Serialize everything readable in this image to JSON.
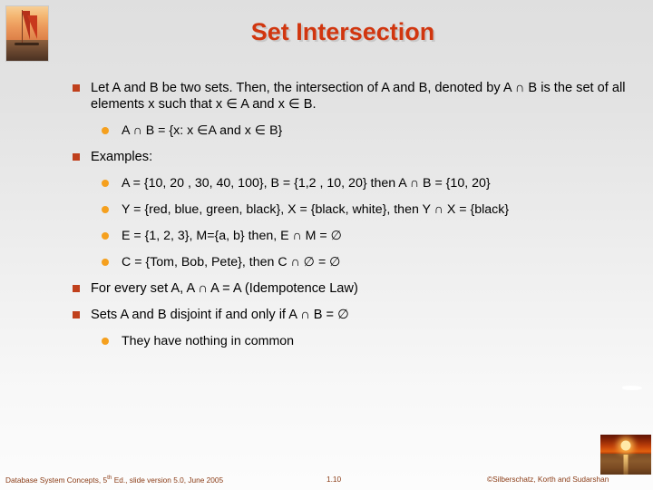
{
  "slide": {
    "title": "Set Intersection",
    "title_color": "#d1360f",
    "background_top": "#dfdfdf",
    "background_bottom": "#fcfcfc",
    "bullet_square_color": "#c0401c",
    "bullet_circle_color": "#f5a01e"
  },
  "images": {
    "logo_alt": "sailboat-at-sunset-photo",
    "corner_alt": "sunset-over-water-photo"
  },
  "content": [
    {
      "level": 1,
      "text": "Let A and B be two sets. Then, the intersection of A and B, denoted by A ∩ B is the set of all elements x such that x ∈ A and  x ∈ B."
    },
    {
      "level": 2,
      "text": "A ∩ B = {x: x ∈A and x ∈ B}"
    },
    {
      "level": 1,
      "text": "Examples:"
    },
    {
      "level": 2,
      "text": "A = {10, 20 , 30, 40, 100}, B = {1,2 , 10, 20} then A ∩ B =  {10, 20}"
    },
    {
      "level": 2,
      "text": "Y = {red, blue, green, black}, X = {black, white}, then Y ∩ X = {black}"
    },
    {
      "level": 2,
      "text": "E = {1, 2, 3}, M={a, b} then, E ∩ M = ∅"
    },
    {
      "level": 2,
      "text": "C = {Tom, Bob, Pete}, then C ∩ ∅ = ∅"
    },
    {
      "level": 1,
      "text": "For every set A, A ∩ A = A (Idempotence Law)"
    },
    {
      "level": 1,
      "text": "Sets A and B disjoint if and only if A ∩ B = ∅"
    },
    {
      "level": 2,
      "text": "They have nothing in common"
    }
  ],
  "footer": {
    "left_prefix": "Database System Concepts, 5",
    "left_sup": "th",
    "left_suffix": " Ed., slide version 5.0, June 2005",
    "slide_number": "1.10",
    "copyright": "©Silberschatz, Korth and Sudarshan"
  }
}
